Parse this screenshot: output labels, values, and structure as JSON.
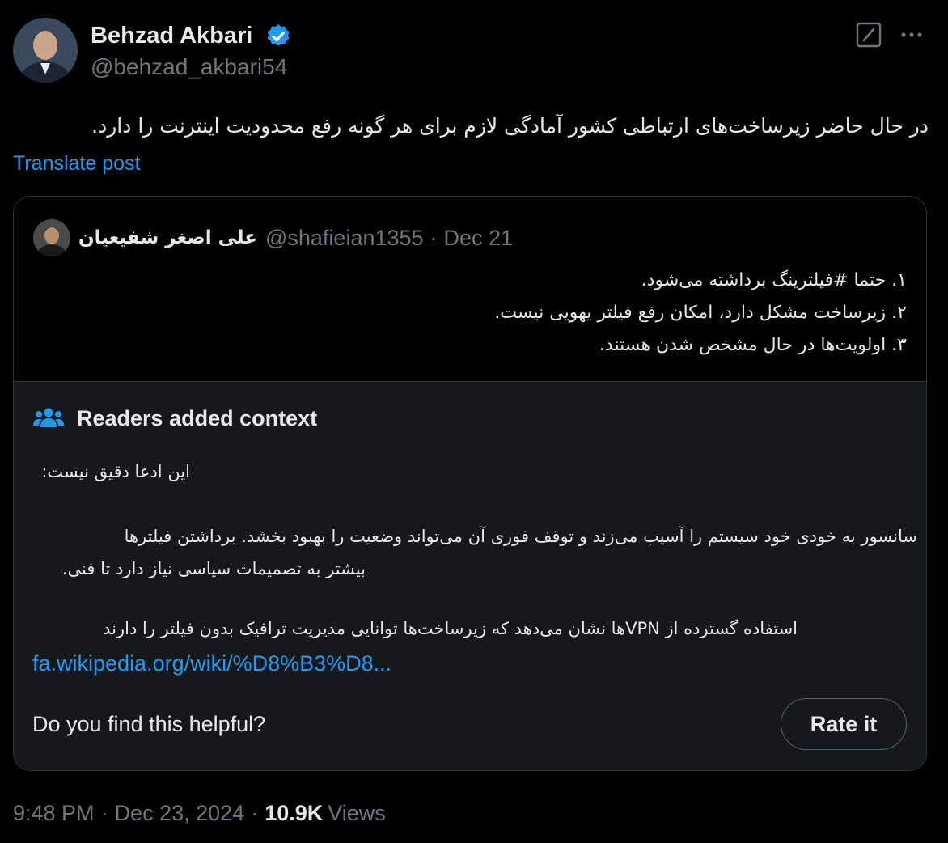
{
  "post": {
    "author_name": "Behzad Akbari",
    "author_handle": "@behzad_akbari54",
    "text": "در حال حاضر زیرساخت‌های ارتباطی کشور آمادگی لازم برای هر گونه رفع محدودیت اینترنت را دارد.",
    "translate_label": "Translate post",
    "time": "9:48 PM",
    "date": "Dec 23, 2024",
    "views_count": "10.9K",
    "views_label": "Views"
  },
  "quote": {
    "author_name": "علی اصغر شفیعیان",
    "author_handle": "@shafieian1355",
    "date": "Dec 21",
    "lines": [
      "۱. حتما #فیلترینگ برداشته می‌شود.",
      "۲. زیرساخت مشکل دارد، امکان رفع فیلتر یهویی نیست.",
      "۳. اولویت‌ها در حال مشخص شدن هستند."
    ]
  },
  "notes": {
    "title": "Readers added context",
    "claim": "این ادعا دقیق نیست:",
    "para1_line1": "سانسور به خودی خود سیستم را آسیب می‌زند و توقف فوری آن می‌تواند وضعیت را بهبود بخشد. برداشتن فیلترها",
    "para1_line2": "بیشتر به تصمیمات سیاسی نیاز دارد تا فنی.",
    "para2_line1": "استفاده گسترده از VPNها نشان می‌دهد که زیرساخت‌ها توانایی مدیریت ترافیک بدون فیلتر را دارند",
    "link": "fa.wikipedia.org/wiki/%D8%B3%D8...",
    "helpful_question": "Do you find this helpful?",
    "rate_label": "Rate it"
  },
  "colors": {
    "background": "#000000",
    "notes_background": "#16181c",
    "link": "#1d9bf0",
    "secondary_text": "#71767b",
    "verified": "#1d9bf0"
  },
  "icons": [
    "verified-badge-icon",
    "grok-icon",
    "more-icon",
    "readers-context-icon"
  ]
}
